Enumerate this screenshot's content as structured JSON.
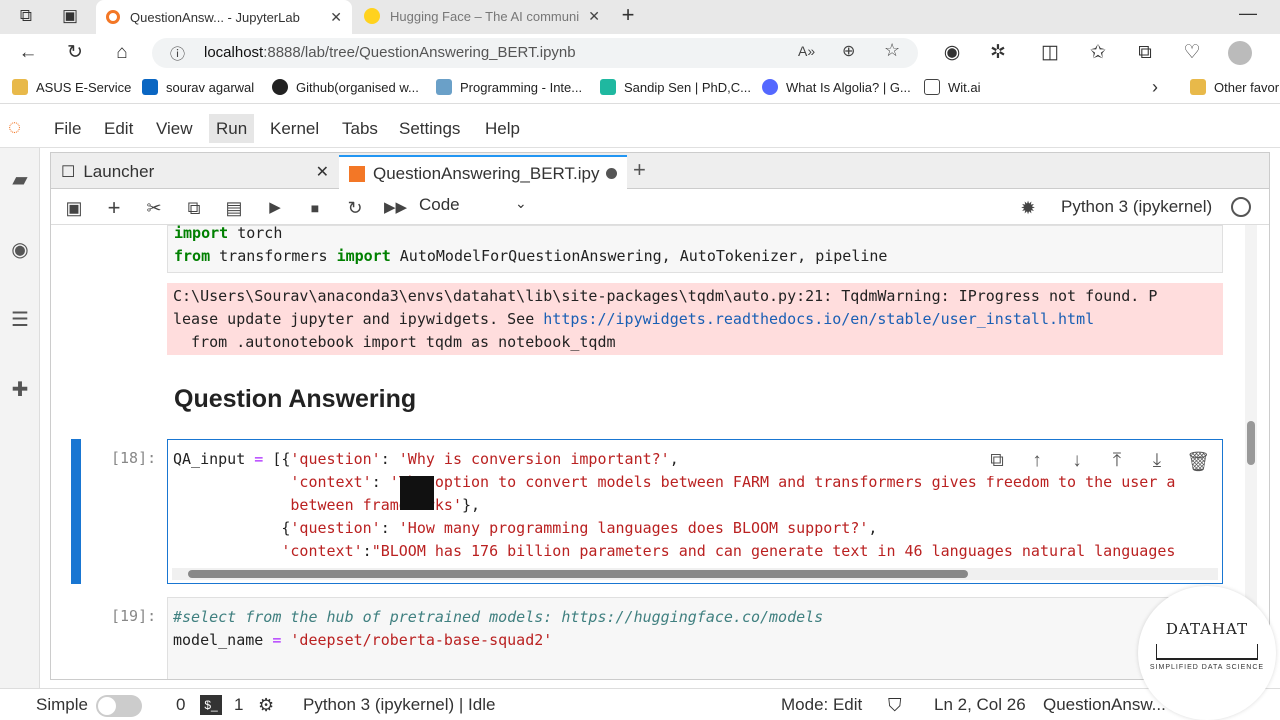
{
  "browser": {
    "tabs": [
      {
        "title": "QuestionAnsw... - JupyterLab",
        "active": true
      },
      {
        "title": "Hugging Face – The AI communi",
        "active": false
      }
    ],
    "url_host": "localhost",
    "url_rest": ":8888/lab/tree/QuestionAnswering_BERT.ipynb",
    "bookmarks": [
      "ASUS E-Service",
      "sourav agarwal",
      "Github(organised w...",
      "Programming - Inte...",
      "Sandip Sen | PhD,C...",
      "What Is Algolia? | G...",
      "Wit.ai",
      "Other favor"
    ]
  },
  "menu": [
    "File",
    "Edit",
    "View",
    "Run",
    "Kernel",
    "Tabs",
    "Settings",
    "Help"
  ],
  "doc_tabs": [
    {
      "label": "Launcher"
    },
    {
      "label": "QuestionAnswering_BERT.ipy"
    }
  ],
  "toolbar": {
    "cell_type": "Code",
    "kernel": "Python 3 (ipykernel)"
  },
  "cells": {
    "import_line1_kw": "import",
    "import_line1_rest": " torch",
    "import_line2_kw1": "from",
    "import_line2_mid": " transformers ",
    "import_line2_kw2": "import",
    "import_line2_rest": " AutoModelForQuestionAnswering, AutoTokenizer, pipeline",
    "stderr_line1": "C:\\Users\\Sourav\\anaconda3\\envs\\datahat\\lib\\site-packages\\tqdm\\auto.py:21: TqdmWarning: IProgress not found. P",
    "stderr_line2_pre": "lease update jupyter and ipywidgets. See ",
    "stderr_line2_link": "https://ipywidgets.readthedocs.io/en/stable/user_install.html",
    "stderr_line3": "  from .autonotebook import tqdm as notebook_tqdm",
    "heading": "Question Answering",
    "prompt18": "[18]:",
    "prompt19": "[19]:",
    "code18_l1a": "QA_input ",
    "code18_l1b": "=",
    "code18_l1c": " [{",
    "code18_l1d": "'question'",
    "code18_l1e": ": ",
    "code18_l1f": "'Why is conversion important?'",
    "code18_l1g": ",",
    "code18_l2a": "             ",
    "code18_l2b": "'context'",
    "code18_l2c": ": ",
    "code18_l2d": "'The option to convert models between FARM and transformers gives freedom to the user a",
    "code18_l3a": "             ",
    "code18_l3b": "between frameworks'",
    "code18_l3c": "},",
    "code18_l4a": "            {",
    "code18_l4b": "'question'",
    "code18_l4c": ": ",
    "code18_l4d": "'How many programming languages does BLOOM support?'",
    "code18_l4e": ",",
    "code18_l5a": "            ",
    "code18_l5b": "'context'",
    "code18_l5c": ":",
    "code18_l5d": "\"BLOOM has 176 billion parameters and can generate text in 46 languages natural languages",
    "code19_l1": "#select from the hub of pretrained models: https://huggingface.co/models",
    "code19_l2a": "model_name ",
    "code19_l2b": "=",
    "code19_l2c": " ",
    "code19_l2d": "'deepset/roberta-base-squad2'"
  },
  "status": {
    "mode_label": "Simple",
    "count_a": "0",
    "count_b": "1",
    "kernel_status": "Python 3 (ipykernel) | Idle",
    "mode": "Mode: Edit",
    "position": "Ln 2, Col 26",
    "file": "QuestionAnsw..."
  },
  "watermark": {
    "title": "DATAHAT",
    "subtitle": "SIMPLIFIED DATA SCIENCE"
  }
}
